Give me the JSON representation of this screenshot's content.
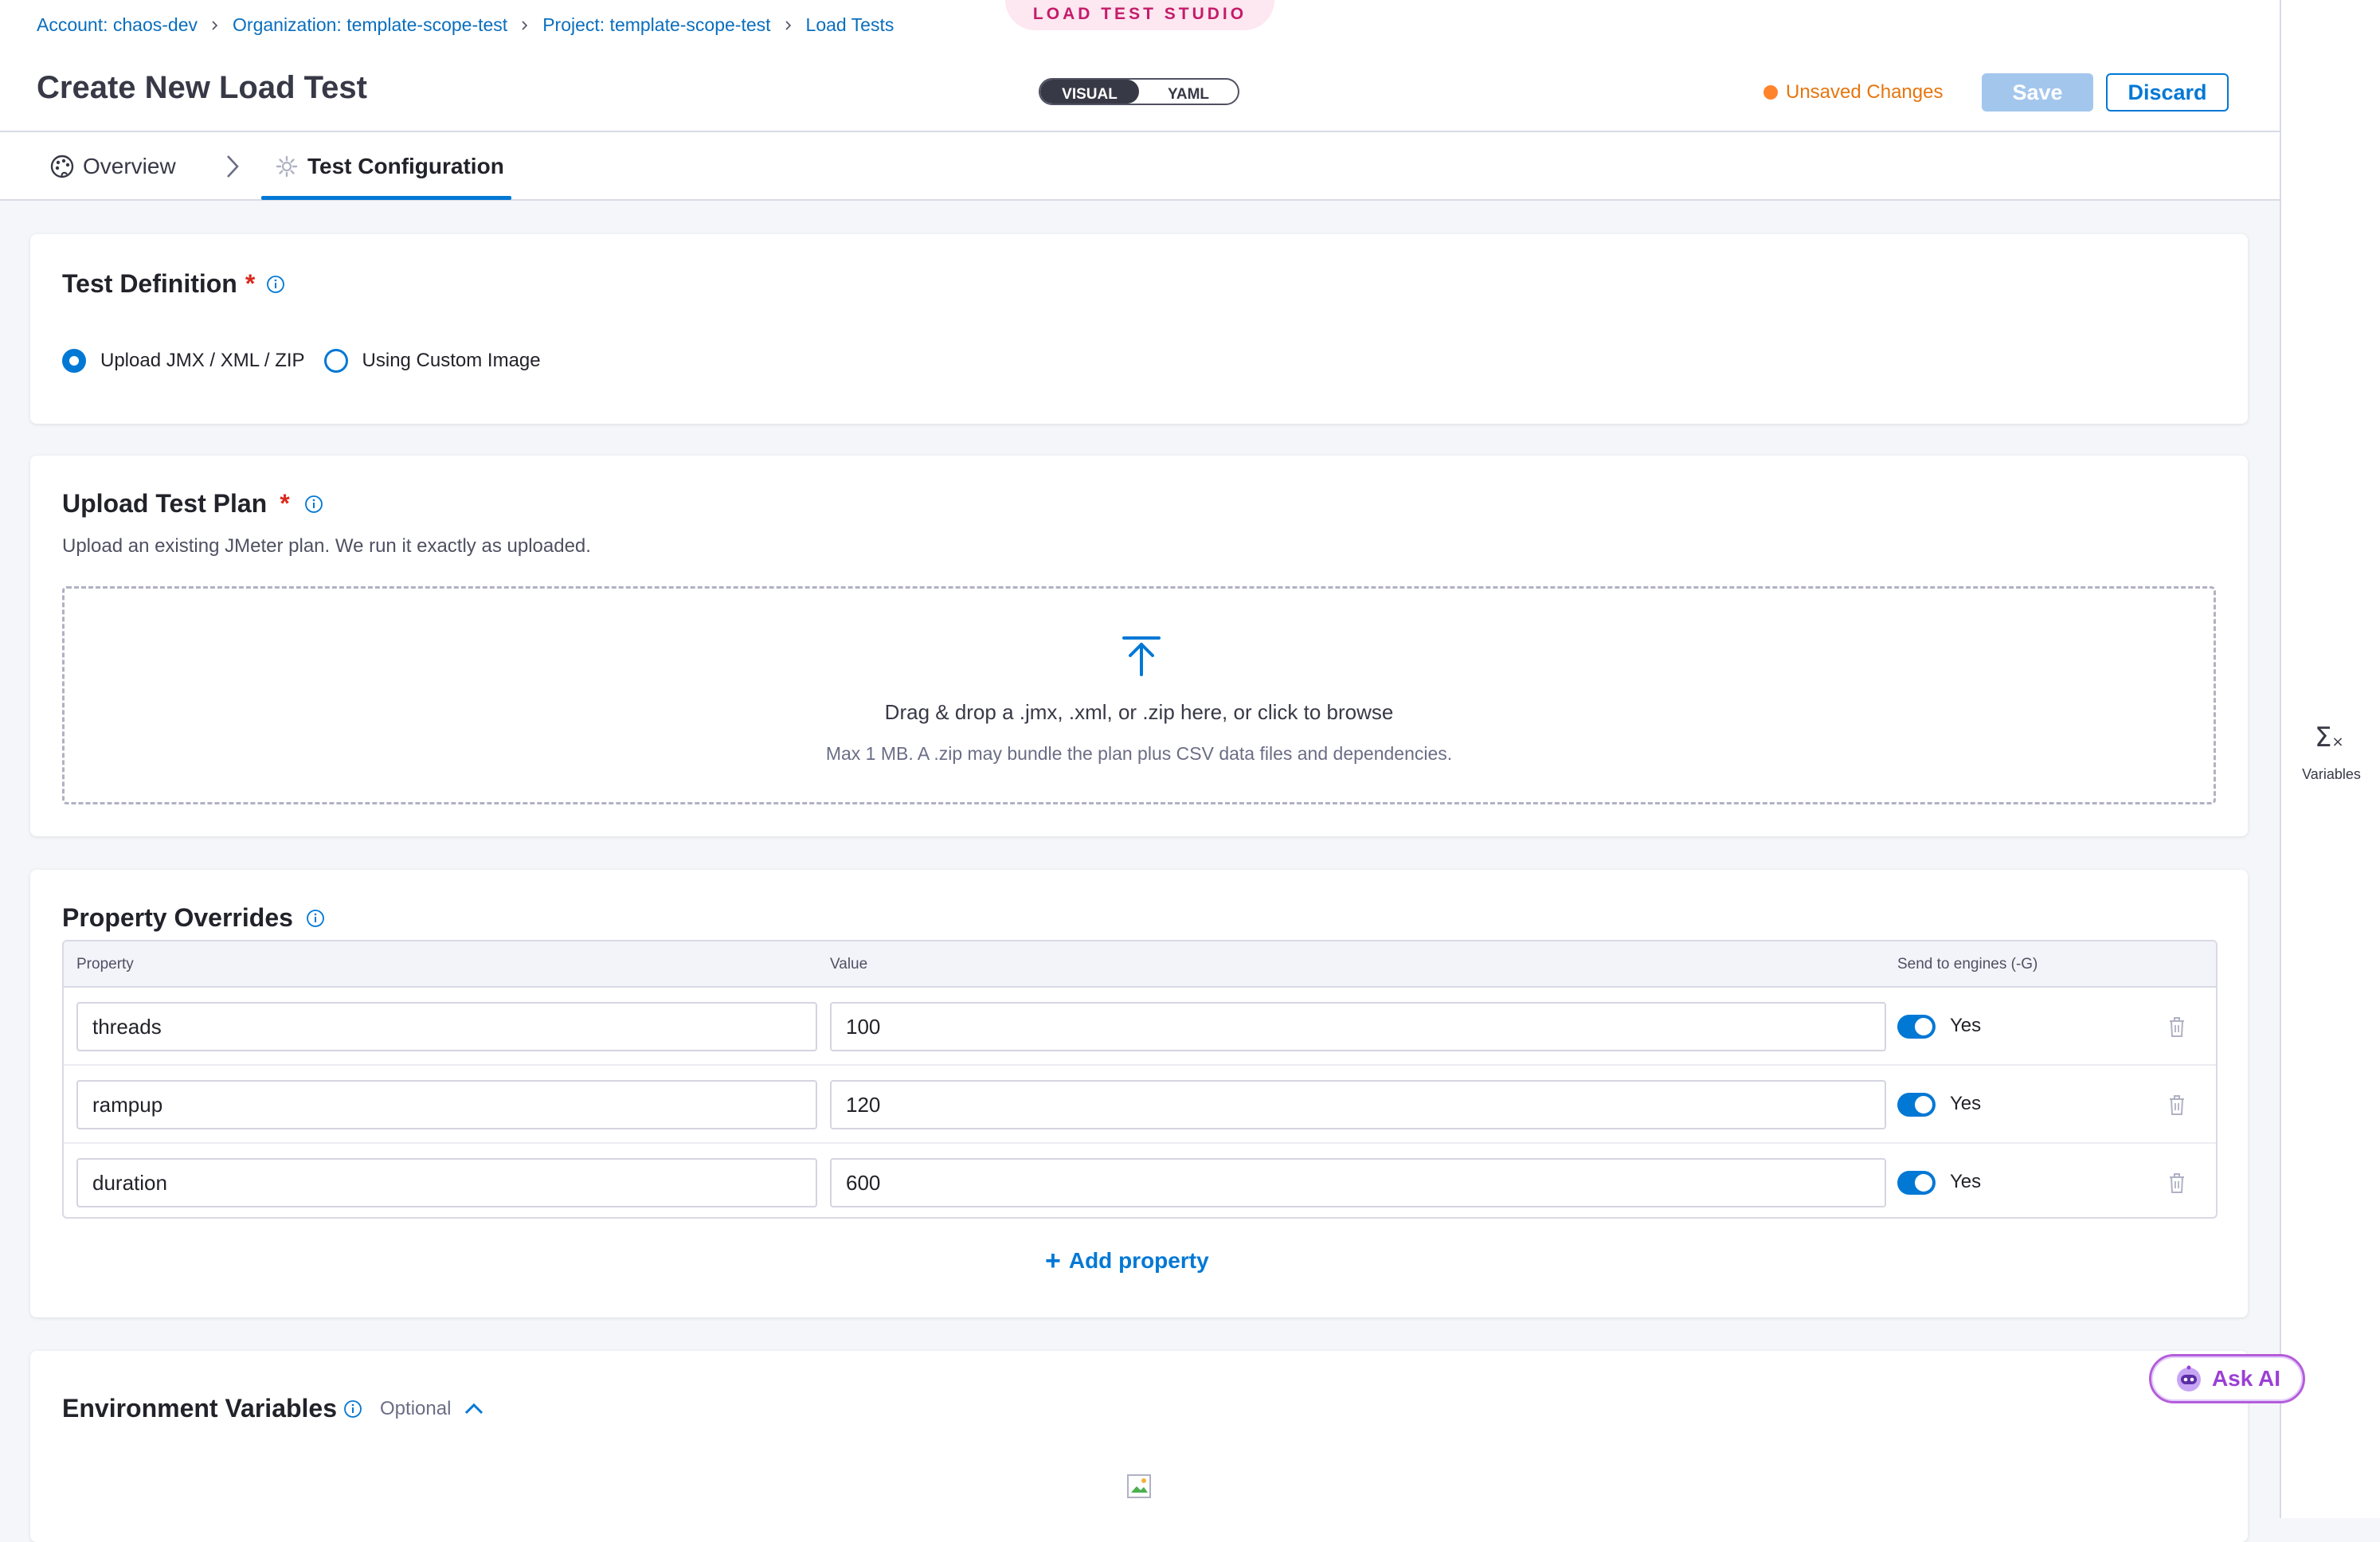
{
  "breadcrumb": {
    "account": "Account: chaos-dev",
    "organization": "Organization: template-scope-test",
    "project": "Project: template-scope-test",
    "section": "Load Tests"
  },
  "studio_tag": "LOAD TEST STUDIO",
  "header": {
    "title": "Create New Load Test",
    "mode_visual": "VISUAL",
    "mode_yaml": "YAML",
    "unsaved": "Unsaved Changes",
    "save": "Save",
    "discard": "Discard"
  },
  "tabs": {
    "overview": "Overview",
    "config": "Test Configuration"
  },
  "rail": {
    "variables": "Variables"
  },
  "test_definition": {
    "title": "Test Definition",
    "required": "*",
    "option_upload": "Upload JMX / XML / ZIP",
    "option_custom": "Using Custom Image",
    "selected": "Upload JMX / XML / ZIP"
  },
  "upload_plan": {
    "title": "Upload Test Plan",
    "required": "*",
    "subtitle": "Upload an existing JMeter plan. We run it exactly as uploaded.",
    "drop_text": "Drag & drop a .jmx, .xml, or .zip here, or click to browse",
    "drop_hint": "Max 1 MB. A .zip may bundle the plan plus CSV data files and dependencies."
  },
  "property_overrides": {
    "title": "Property Overrides",
    "columns": {
      "property": "Property",
      "value": "Value",
      "send": "Send to engines (-G)"
    },
    "rows": [
      {
        "property": "threads",
        "value": "100",
        "send": "Yes"
      },
      {
        "property": "rampup",
        "value": "120",
        "send": "Yes"
      },
      {
        "property": "duration",
        "value": "600",
        "send": "Yes"
      }
    ],
    "add_label": "Add property"
  },
  "env_vars": {
    "title": "Environment Variables",
    "optional": "Optional"
  },
  "ask_ai": "Ask AI",
  "colors": {
    "primary": "#0278d5",
    "unsaved": "#ff832b",
    "required": "#da291d",
    "studio_pink": "#c41c6a"
  }
}
